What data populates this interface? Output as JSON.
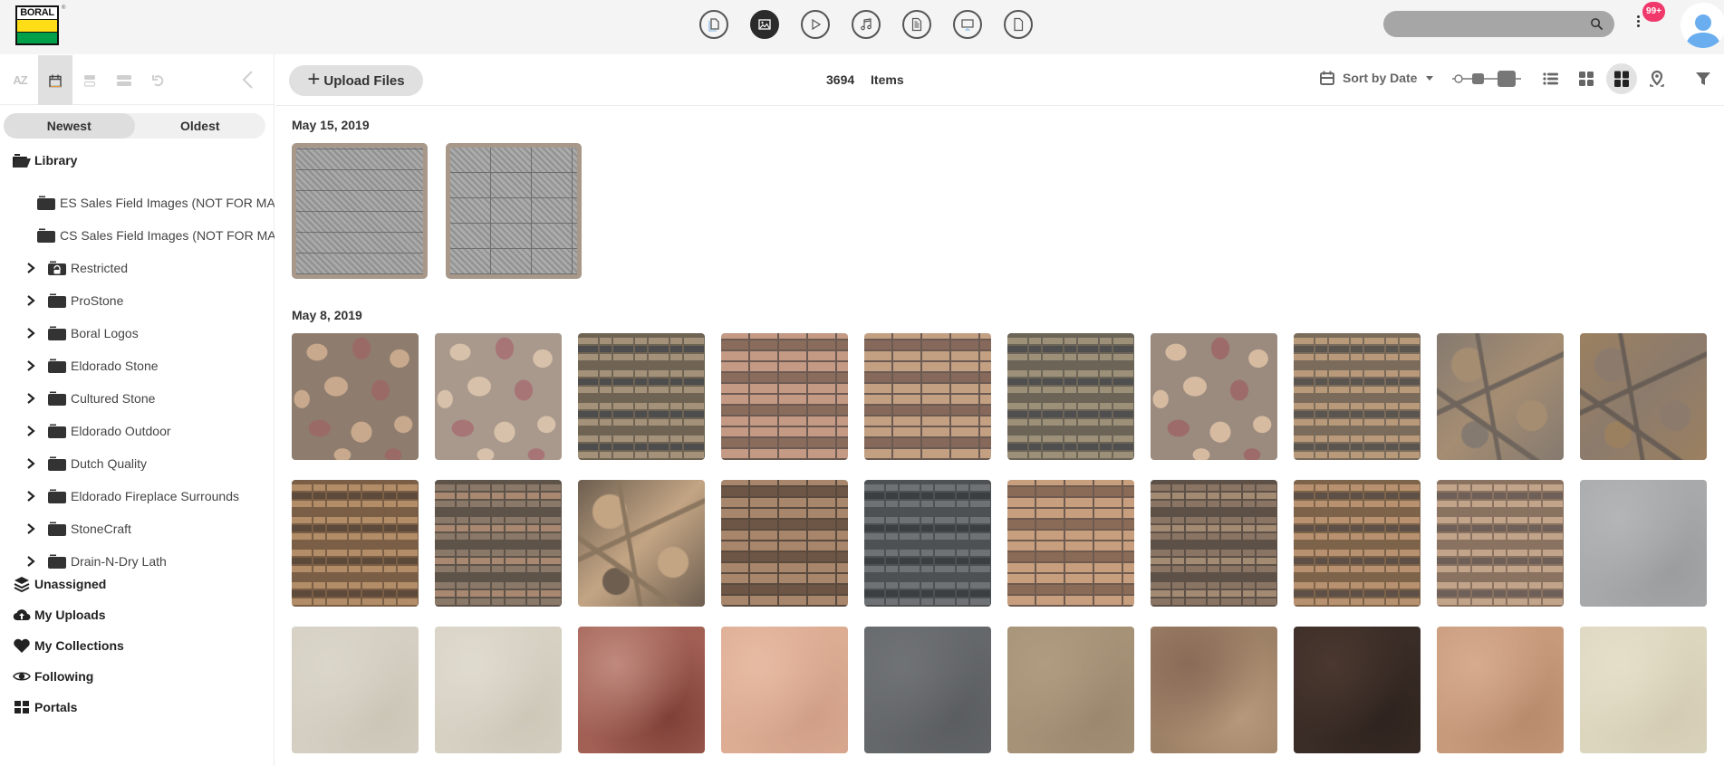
{
  "brand": {
    "logo_text": "BORAL",
    "colors": {
      "yellow": "#ffde17",
      "green": "#00a04b"
    }
  },
  "topbar": {
    "file_types": [
      {
        "name": "all-files",
        "icon": "files-icon",
        "active": false
      },
      {
        "name": "images",
        "icon": "image-icon",
        "active": true
      },
      {
        "name": "video",
        "icon": "play-icon",
        "active": false
      },
      {
        "name": "audio",
        "icon": "music-icon",
        "active": false
      },
      {
        "name": "documents",
        "icon": "document-icon",
        "active": false
      },
      {
        "name": "presentations",
        "icon": "monitor-icon",
        "active": false
      },
      {
        "name": "other",
        "icon": "file-icon",
        "active": false
      }
    ],
    "search": {
      "value": "",
      "placeholder": ""
    },
    "notification_count": "99+",
    "accent_badge_color": "#f0386b"
  },
  "sidebar": {
    "sort_tools": [
      {
        "label": "AZ",
        "icon": "az-sort-icon",
        "active": false
      },
      {
        "label": "",
        "icon": "calendar-icon",
        "active": true
      },
      {
        "label": "",
        "icon": "expand-rows-icon",
        "active": false
      },
      {
        "label": "",
        "icon": "collapse-rows-icon",
        "active": false
      },
      {
        "label": "",
        "icon": "undo-icon",
        "active": false
      }
    ],
    "order": {
      "newest": "Newest",
      "oldest": "Oldest",
      "selected": "Newest"
    },
    "library_label": "Library",
    "folders": [
      {
        "label": "ES Sales Field Images (NOT FOR MARKETING)",
        "locked": false
      },
      {
        "label": "CS Sales Field Images (NOT FOR MARKETING)",
        "locked": false
      },
      {
        "label": "Restricted",
        "locked": true
      },
      {
        "label": "ProStone",
        "locked": false
      },
      {
        "label": "Boral Logos",
        "locked": false
      },
      {
        "label": "Eldorado Stone",
        "locked": false
      },
      {
        "label": "Cultured Stone",
        "locked": false
      },
      {
        "label": "Eldorado Outdoor",
        "locked": false
      },
      {
        "label": "Dutch Quality",
        "locked": false
      },
      {
        "label": "Eldorado Fireplace Surrounds",
        "locked": false
      },
      {
        "label": "StoneCraft",
        "locked": false
      },
      {
        "label": "Drain-N-Dry Lath",
        "locked": false
      }
    ],
    "links": [
      {
        "label": "Unassigned",
        "icon": "layers-icon"
      },
      {
        "label": "My Uploads",
        "icon": "cloud-upload-icon"
      },
      {
        "label": "My Collections",
        "icon": "heart-icon"
      },
      {
        "label": "Following",
        "icon": "eye-icon"
      },
      {
        "label": "Portals",
        "icon": "grid-icon"
      }
    ]
  },
  "toolbar": {
    "upload_label": "Upload Files",
    "item_count": "3694",
    "items_label": "Items",
    "sort_label": "Sort by Date",
    "view_modes": [
      {
        "name": "list",
        "active": false
      },
      {
        "name": "grid-small",
        "active": false
      },
      {
        "name": "grid-large",
        "active": true
      },
      {
        "name": "map",
        "active": false
      }
    ],
    "thumbnail_size_level": "large"
  },
  "groups": [
    {
      "date": "May 15, 2019",
      "assets": [
        {
          "type": "ledge-gray",
          "base": "#a9a9a9",
          "alt": "#8f8f8f"
        },
        {
          "type": "block-gray",
          "base": "#ababab",
          "alt": "#909090"
        }
      ]
    },
    {
      "date": "May 8, 2019",
      "assets": [
        {
          "type": "river",
          "base": "#8e7d6e",
          "alt": "#c9a98d",
          "alt2": "#9a6b66"
        },
        {
          "type": "river",
          "base": "#a8998c",
          "alt": "#d8c1aa",
          "alt2": "#a87576"
        },
        {
          "type": "ledge",
          "base": "#6f6454",
          "alt": "#a4917a",
          "alt2": "#4e4d4e"
        },
        {
          "type": "brick",
          "base": "#8a6c5c",
          "alt": "#c49a84",
          "alt2": "#6c5a52"
        },
        {
          "type": "brick",
          "base": "#86695a",
          "alt": "#c4a083",
          "alt2": "#6a5a52"
        },
        {
          "type": "ledge",
          "base": "#6b6457",
          "alt": "#9c9078",
          "alt2": "#4f4f4f"
        },
        {
          "type": "river",
          "base": "#9b8b7f",
          "alt": "#d6bba1",
          "alt2": "#9c6b6a"
        },
        {
          "type": "ledge",
          "base": "#7b6b5b",
          "alt": "#b89a7a",
          "alt2": "#5b5550"
        },
        {
          "type": "field",
          "base": "#6f655c",
          "alt": "#a58d72",
          "alt2": "#857a70"
        },
        {
          "type": "field",
          "base": "#695e55",
          "alt": "#8c7b6c",
          "alt2": "#9b8060"
        },
        {
          "type": "ledge",
          "base": "#7a5e45",
          "alt": "#b28d68",
          "alt2": "#5e4a3a"
        },
        {
          "type": "ledge",
          "base": "#5e5349",
          "alt": "#8a7868",
          "alt2": "#a88870"
        },
        {
          "type": "field",
          "base": "#8b765f",
          "alt": "#c3a584",
          "alt2": "#6d5e50"
        },
        {
          "type": "brick",
          "base": "#6e5646",
          "alt": "#a8866b",
          "alt2": "#5a4a3e"
        },
        {
          "type": "ledge",
          "base": "#4d5153",
          "alt": "#6e7274",
          "alt2": "#3c3f41"
        },
        {
          "type": "brick",
          "base": "#8a6b57",
          "alt": "#c89f7e",
          "alt2": "#6e5a4e"
        },
        {
          "type": "ledge",
          "base": "#5d5046",
          "alt": "#8a7565",
          "alt2": "#a38a72"
        },
        {
          "type": "ledge",
          "base": "#7d6349",
          "alt": "#b89270",
          "alt2": "#5e5046"
        },
        {
          "type": "ledge",
          "base": "#8a7260",
          "alt": "#c2a48b",
          "alt2": "#6e6058"
        },
        {
          "type": "smooth",
          "base": "#a7a9ab",
          "alt": "#9a9c9e",
          "alt2": "#b4b5b6"
        },
        {
          "type": "smooth",
          "base": "#d4cfc2",
          "alt": "#cbc5b6",
          "alt2": "#dbd6ca"
        },
        {
          "type": "smooth",
          "base": "#d6d1c3",
          "alt": "#cdc7b8",
          "alt2": "#e0dbcf"
        },
        {
          "type": "smooth",
          "base": "#a26055",
          "alt": "#7e3f36",
          "alt2": "#c08a7e"
        },
        {
          "type": "smooth",
          "base": "#dcac93",
          "alt": "#d09e86",
          "alt2": "#e7bba3"
        },
        {
          "type": "smooth",
          "base": "#65686a",
          "alt": "#5a5d5f",
          "alt2": "#707375"
        },
        {
          "type": "smooth",
          "base": "#a69277",
          "alt": "#9b876d",
          "alt2": "#b09c80"
        },
        {
          "type": "smooth",
          "base": "#9d8166",
          "alt": "#b79a7c",
          "alt2": "#8a6b58"
        },
        {
          "type": "smooth",
          "base": "#3a2c26",
          "alt": "#2e231e",
          "alt2": "#4a3830"
        },
        {
          "type": "smooth",
          "base": "#c89a7c",
          "alt": "#b88a6c",
          "alt2": "#d6ab8e"
        },
        {
          "type": "smooth",
          "base": "#ddd6bf",
          "alt": "#d3cbb2",
          "alt2": "#e5dfca"
        }
      ]
    }
  ]
}
